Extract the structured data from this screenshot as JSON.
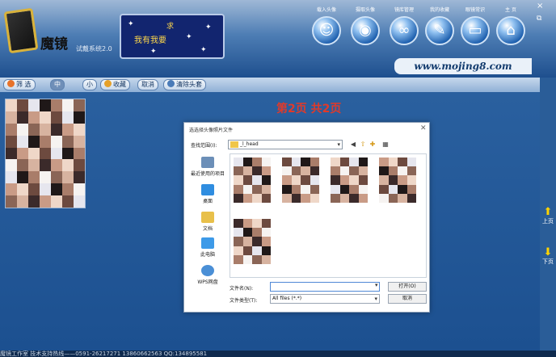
{
  "header": {
    "logo_text": "魔镜",
    "logo_sub": "试戴系统2.0",
    "slogan_main": "我有我要",
    "slogan_top": "求",
    "url": "www.mojing8.com",
    "nav": [
      {
        "label": "载入头像",
        "icon": "person-icon",
        "glyph": "☺"
      },
      {
        "label": "摄取头像",
        "icon": "webcam-icon",
        "glyph": "◉"
      },
      {
        "label": "镜库管理",
        "icon": "glasses-icon",
        "glyph": "∞"
      },
      {
        "label": "我的收藏",
        "icon": "folder-icon",
        "glyph": "✎"
      },
      {
        "label": "眼镜常识",
        "icon": "laptop-icon",
        "glyph": "▭"
      },
      {
        "label": "主 页",
        "icon": "home-icon",
        "glyph": "⌂"
      }
    ]
  },
  "toolbar": {
    "filter_label": "筛 选",
    "b2_label": "中",
    "b3_label": "小",
    "favorite_label": "收藏",
    "cancel_label": "取消",
    "clear_label": "清除头套"
  },
  "content": {
    "page_indicator": "第2页  共2页"
  },
  "sidebar_right": {
    "up_label": "上页",
    "down_label": "下页"
  },
  "statusbar": {
    "text": "魔镜工作室        技术支持热线——0591-26217271 13860662563 QQ:134895581"
  },
  "dialog": {
    "title": "选选择头像照片文件",
    "look_in_label": "查找范围(I):",
    "look_in_value": "_l_head",
    "places": [
      {
        "label": "最近使用的项目",
        "icon": "recent-icon",
        "color": "#6c8fb8"
      },
      {
        "label": "桌面",
        "icon": "desktop-icon",
        "color": "#2f8de0"
      },
      {
        "label": "文档",
        "icon": "documents-icon",
        "color": "#e8c04a"
      },
      {
        "label": "此电脑",
        "icon": "computer-icon",
        "color": "#3d9ae8"
      },
      {
        "label": "WPS网盘",
        "icon": "cloud-icon",
        "color": "#4a8fd6"
      }
    ],
    "filename_label": "文件名(N):",
    "filename_value": "",
    "filetype_label": "文件类型(T):",
    "filetype_value": "All files (*.*)",
    "open_label": "打开(O)",
    "cancel_label": "取消"
  },
  "colors": {
    "header_top": "#9fb8d6",
    "background": "#1c5090",
    "page_indicator": "#e03a2a",
    "url_text": "#123b6e"
  }
}
